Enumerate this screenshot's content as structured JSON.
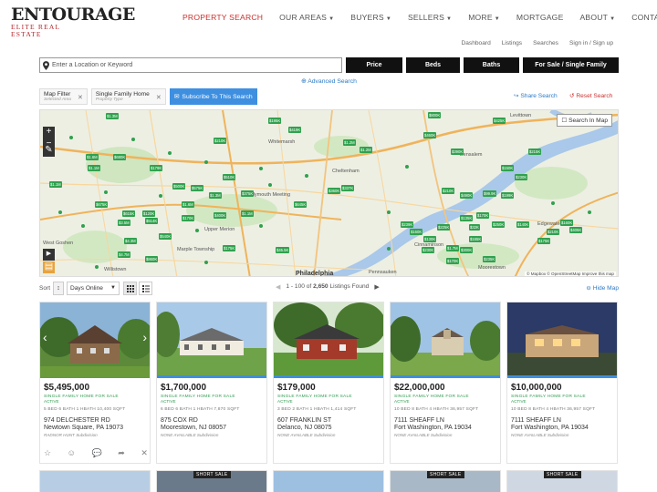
{
  "brand": {
    "name": "ENTOURAGE",
    "tagline": "ELITE REAL ESTATE"
  },
  "nav": [
    {
      "label": "PROPERTY SEARCH",
      "active": true,
      "caret": false
    },
    {
      "label": "OUR AREAS",
      "caret": true
    },
    {
      "label": "BUYERS",
      "caret": true
    },
    {
      "label": "SELLERS",
      "caret": true
    },
    {
      "label": "MORE",
      "caret": true
    },
    {
      "label": "MORTGAGE",
      "caret": false
    },
    {
      "label": "ABOUT",
      "caret": true
    },
    {
      "label": "CONTACT",
      "caret": true
    }
  ],
  "subnav": [
    "Dashboard",
    "Listings",
    "Searches",
    "Sign in / Sign up"
  ],
  "search": {
    "placeholder": "Enter a Location or Keyword",
    "price_label": "Price",
    "beds_label": "Beds",
    "baths_label": "Baths",
    "type_label": "For Sale / Single Family",
    "advanced_label": "Advanced Search"
  },
  "chips": [
    {
      "title": "Map Filter",
      "subtitle": "Selected Area"
    },
    {
      "title": "Single Family Home",
      "subtitle": "Property Type"
    }
  ],
  "subscribe_label": "Subscribe To This Search",
  "share_label": "Share Search",
  "reset_label": "Reset Search",
  "map": {
    "search_in_map": "Search In Map",
    "attribution": "© Mapbox © OpenStreetMap Improve this map",
    "cities": [
      "Levittown",
      "Whitemarsh",
      "Bensalem",
      "Cheltenham",
      "Plymouth Meeting",
      "Edgewater Park",
      "West Goshen",
      "Willistown",
      "Marple Township",
      "Philadelphia",
      "Pennsauken",
      "Cinnaminson",
      "Moorestown",
      "Upper Merion"
    ]
  },
  "sort": {
    "label": "Sort",
    "selected": "Days Online",
    "pager": "1 - 100 of",
    "total": "2,650",
    "pager_suffix": "Listings Found",
    "hide_map": "Hide Map"
  },
  "listings": [
    {
      "price": "$5,495,000",
      "type": "SINGLE FAMILY HOME FOR SALE",
      "status": "ACTIVE",
      "specs": "5 BED   6 BATH   1 HBATH   10,400 SQFT",
      "addr1": "974 DELCHESTER RD",
      "addr2": "Newtown Square, PA 19073",
      "subdiv": "RADNOR HUNT Subdivision"
    },
    {
      "price": "$1,700,000",
      "type": "SINGLE FAMILY HOME FOR SALE",
      "status": "ACTIVE",
      "specs": "6 BED   6 BATH   1 HBATH   7,870 SQFT",
      "addr1": "875 COX RD",
      "addr2": "Moorestown, NJ 08057",
      "subdiv": "NONE AVAILABLE Subdivision"
    },
    {
      "price": "$179,000",
      "type": "SINGLE FAMILY HOME FOR SALE",
      "status": "ACTIVE",
      "specs": "3 BED   2 BATH   1 HBATH   1,414 SQFT",
      "addr1": "607 FRANKLIN ST",
      "addr2": "Delanco, NJ 08075",
      "subdiv": "NONE AVAILABLE Subdivision"
    },
    {
      "price": "$22,000,000",
      "type": "SINGLE FAMILY HOME FOR SALE",
      "status": "ACTIVE",
      "specs": "10 BED   8 BATH   4 HBATH   36,957 SQFT",
      "addr1": "7111 SHEAFF LN",
      "addr2": "Fort Washington, PA 19034",
      "subdiv": "NONE AVAILABLE Subdivision"
    },
    {
      "price": "$10,000,000",
      "type": "SINGLE FAMILY HOME FOR SALE",
      "status": "ACTIVE",
      "specs": "10 BED   8 BATH   4 HBATH   36,957 SQFT",
      "addr1": "7111 SHEAFF LN",
      "addr2": "Fort Washington, PA 19034",
      "subdiv": "NONE AVAILABLE Subdivision"
    }
  ],
  "next_row_badges": [
    "",
    "SHORT SALE",
    "",
    "SHORT SALE",
    "SHORT SALE"
  ],
  "colors": {
    "accent": "#c8302e",
    "link": "#2a7ac4",
    "pin": "#30a14e",
    "button": "#111111"
  }
}
